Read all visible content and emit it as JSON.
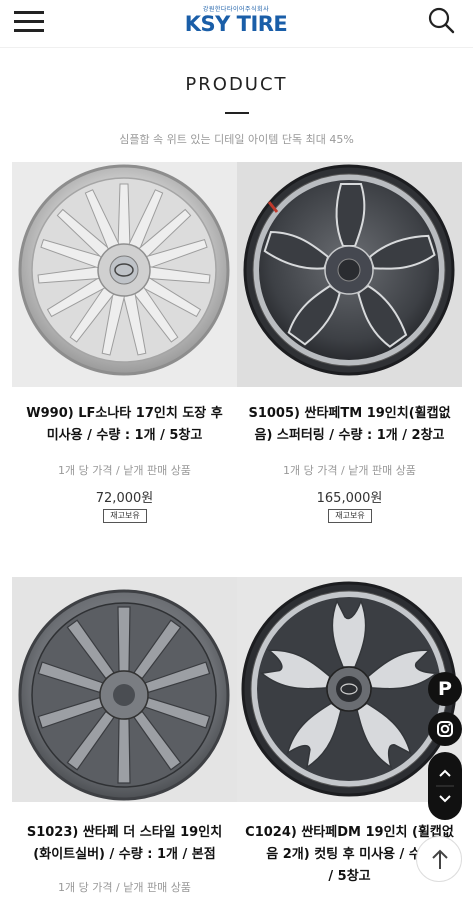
{
  "header": {
    "logo_sub": "강원한다타이어주식회사",
    "logo_main": "KSY TIRE",
    "menu_icon": "hamburger-menu-icon",
    "search_icon": "search-icon"
  },
  "section": {
    "title": "PRODUCT",
    "subtitle": "심플함 속 위트 있는 디테일 아이템 단독 최대 45%"
  },
  "products": [
    {
      "name_line1": "W990) LF소나타 17인치 도장 후",
      "name_line2": "미사용 / 수량 : 1개 / 5창고",
      "price_label": "1개 당 가격 / 낱개 판매 상품",
      "price": "72,000원",
      "badge": "재고보유",
      "wheel_color": "silver"
    },
    {
      "name_line1": "S1005) 싼타페TM 19인치(휠캡없",
      "name_line2": "음) 스퍼터링 / 수량 : 1개 / 2창고",
      "price_label": "1개 당 가격 / 낱개 판매 상품",
      "price": "165,000원",
      "badge": "재고보유",
      "wheel_color": "dark-machined"
    },
    {
      "name_line1": "S1023) 싼타페 더 스타일 19인치",
      "name_line2": "(화이트실버) / 수량 : 1개 / 본점",
      "price_label": "1개 당 가격 / 낱개 판매 상품",
      "wheel_color": "gunmetal"
    },
    {
      "name_line1": "C1024) 싼타페DM 19인치 (휠캡없",
      "name_line2": "음 2개) 컷팅 후 미사용 / 수량",
      "name_line3": "/ 5창고",
      "wheel_color": "dark-machined"
    }
  ],
  "floating": {
    "p_label": "P",
    "p_icon": "p-brand-icon",
    "instagram_icon": "instagram-icon",
    "up_icon": "chevron-up-icon",
    "down_icon": "chevron-down-icon",
    "top_icon": "arrow-up-icon"
  },
  "colors": {
    "brand": "#1a5ea8",
    "text": "#111111",
    "muted": "#999999"
  }
}
